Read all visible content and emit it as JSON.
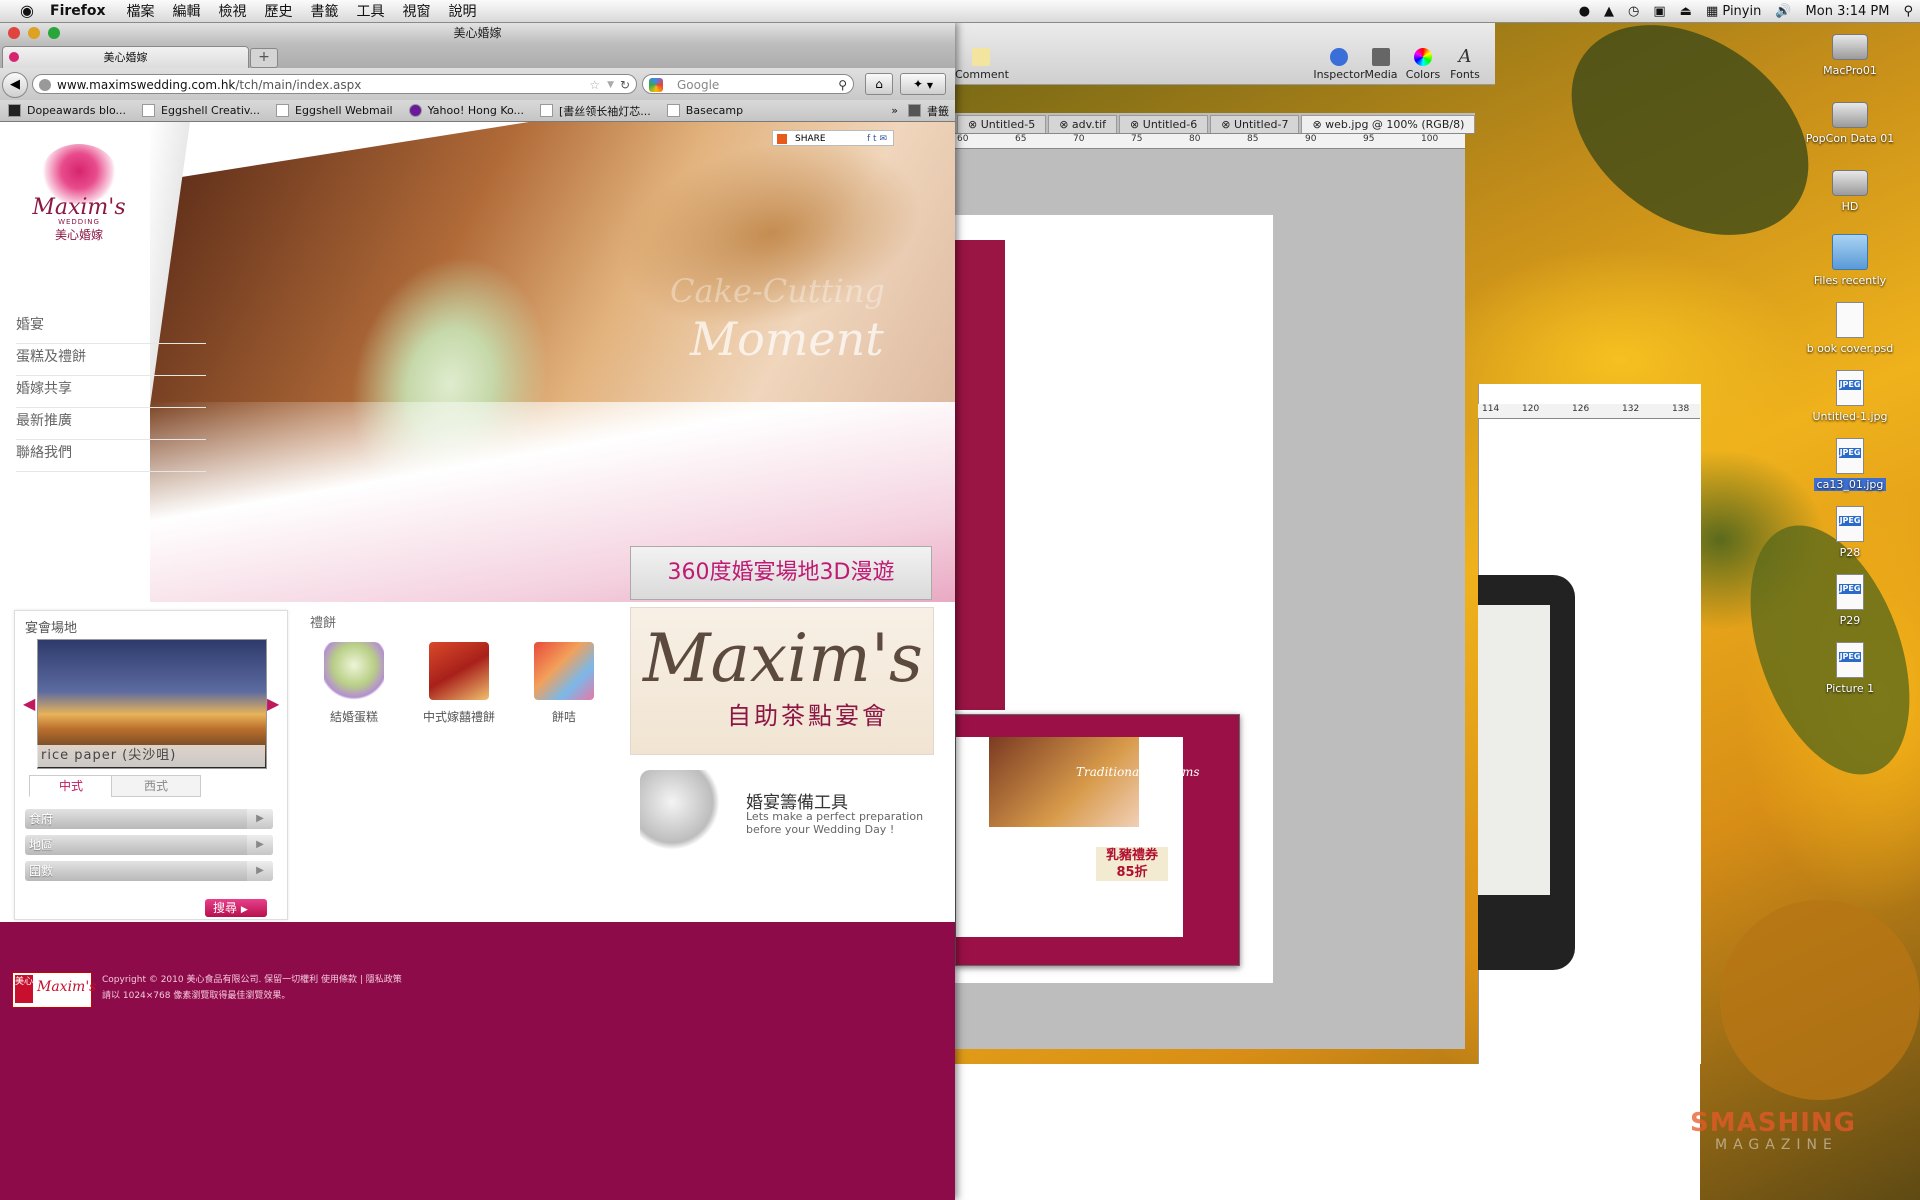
{
  "menubar": {
    "apple_icon": "apple-icon",
    "app": "Firefox",
    "items": [
      "檔案",
      "編輯",
      "檢視",
      "歷史",
      "書籤",
      "工具",
      "視窗",
      "說明"
    ],
    "input_method": "Pinyin",
    "clock": "Mon 3:14 PM"
  },
  "desktop_icons": [
    {
      "label": "MacPro01",
      "kind": "disk"
    },
    {
      "label": "PopCon Data 01",
      "kind": "disk"
    },
    {
      "label": "HD",
      "kind": "disk"
    },
    {
      "label": "Files recently",
      "kind": "folder"
    },
    {
      "label": "b ook cover.psd",
      "kind": "psd"
    },
    {
      "label": "Untitled-1.jpg",
      "kind": "jpeg"
    },
    {
      "label": "ca13_01.jpg",
      "kind": "jpeg"
    },
    {
      "label": "P28",
      "kind": "jpeg"
    },
    {
      "label": "P29",
      "kind": "jpeg"
    },
    {
      "label": "Picture 1",
      "kind": "jpeg"
    }
  ],
  "photoshop": {
    "toolbar": [
      "Inspector",
      "Media",
      "Colors",
      "Fonts"
    ],
    "comment_label": "Comment",
    "tabs": [
      "Untitled-5",
      "adv.tif",
      "Untitled-6",
      "Untitled-7",
      "web.jpg @ 100% (RGB/8)"
    ],
    "ruler_marks": [
      "60",
      "65",
      "70",
      "75",
      "80",
      "85",
      "90",
      "95",
      "100"
    ],
    "ruler2_marks": [
      "114",
      "120",
      "126",
      "132",
      "138"
    ],
    "mini_tag": "乳豬禮券 85折",
    "mini_custom": "Traditional Customs"
  },
  "watermark": {
    "line1": "SMASHING",
    "line2": "MAGAZINE"
  },
  "firefox": {
    "window_title": "美心婚嫁",
    "tab_title": "美心婚嫁",
    "new_tab": "+",
    "url_host": "www.maximswedding.com.hk",
    "url_path": "/tch/main/index.aspx",
    "search_placeholder": "Google",
    "bookmarks": [
      "Dopeawards blo...",
      "Eggshell Creativ...",
      "Eggshell Webmail",
      "Yahoo! Hong Ko...",
      "[書丝领长袖灯芯...",
      "Basecamp",
      "書籤"
    ]
  },
  "site": {
    "logo_brand": "Maxim's",
    "logo_sub": "WEDDING",
    "logo_cn": "美心婚嫁",
    "nav": [
      "婚宴",
      "蛋糕及禮餅",
      "婚嫁共享",
      "最新推廣",
      "聯絡我們"
    ],
    "share_label": "SHARE",
    "hero_script": "Moment",
    "hero_script_small": "Cake-Cutting",
    "tour_button": "360度婚宴場地3D漫遊",
    "venue_title": "宴會場地",
    "venue_caption": "rice paper (尖沙咀)",
    "venue_tabs": [
      "中式",
      "西式"
    ],
    "venue_selects": [
      "食府",
      "地區",
      "圍數"
    ],
    "search_button": "搜尋",
    "gifts_title": "禮餅",
    "gifts": [
      "結婚蛋糕",
      "中式嫁囍禮餅",
      "餅咭"
    ],
    "promo_brand": "Maxim's",
    "promo_cn": "自助茶點宴會",
    "tools_title": "婚宴籌備工具",
    "tools_line1": "Lets make a perfect preparation",
    "tools_line2": "before your Wedding Day !",
    "footer_copy1": "Copyright © 2010  美心食品有限公司. 保留一切權利     使用條款  |  隱私政策",
    "footer_copy2": "請以 1024×768 像素瀏覽取得最佳瀏覽效果。",
    "footer_logo_cn": "美心",
    "footer_logo_brand": "Maxim's"
  }
}
